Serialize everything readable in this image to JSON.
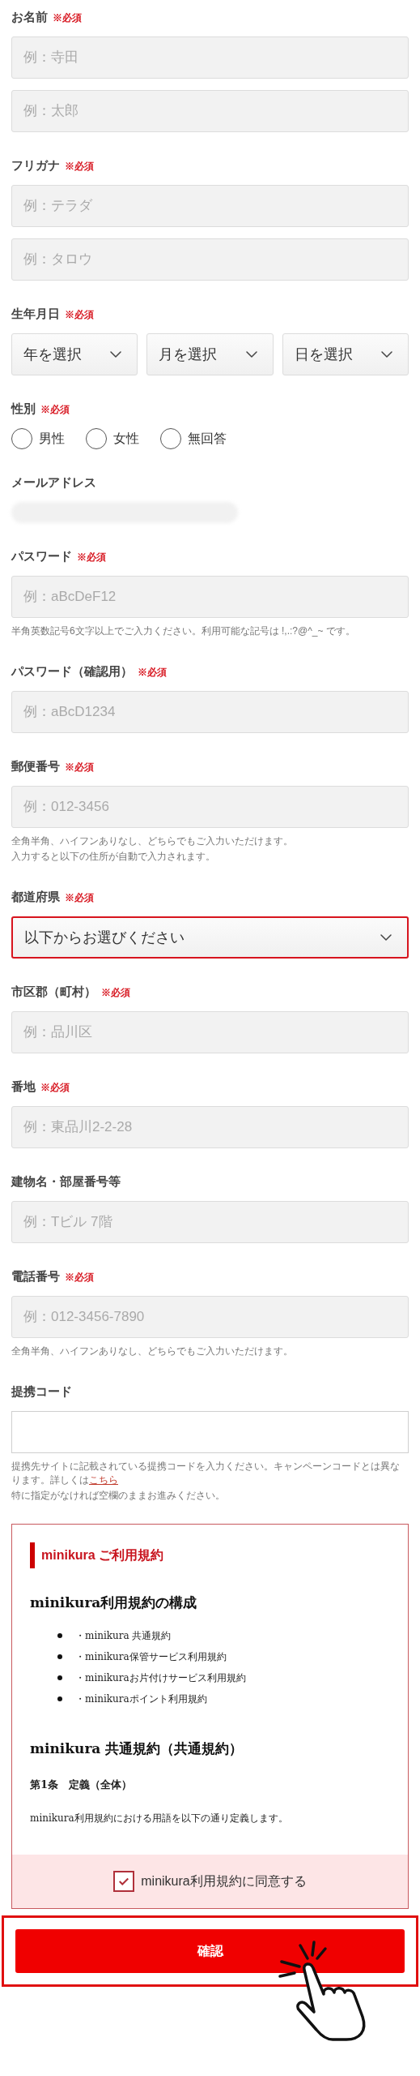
{
  "form": {
    "fields": [
      {
        "kind": "text",
        "label": "お名前",
        "required": "※必須",
        "inputs": [
          {
            "placeholder": "例：寺田"
          },
          {
            "placeholder": "例：太郎"
          }
        ]
      },
      {
        "kind": "text",
        "label": "フリガナ",
        "required": "※必須",
        "inputs": [
          {
            "placeholder": "例：テラダ"
          },
          {
            "placeholder": "例：タロウ"
          }
        ]
      },
      {
        "kind": "selects",
        "label": "生年月日",
        "required": "※必須",
        "selects": [
          {
            "value": "年を選択",
            "invalid": false
          },
          {
            "value": "月を選択",
            "invalid": false
          },
          {
            "value": "日を選択",
            "invalid": false
          }
        ]
      },
      {
        "kind": "radio",
        "label": "性別",
        "required": "※必須",
        "options": [
          {
            "label": "男性",
            "selected": false
          },
          {
            "label": "女性",
            "selected": false
          },
          {
            "label": "無回答",
            "selected": false
          }
        ]
      },
      {
        "kind": "redacted",
        "label": "メールアドレス"
      },
      {
        "kind": "text",
        "label": "パスワード",
        "required": "※必須",
        "inputs": [
          {
            "placeholder": "例：aBcDeF12"
          }
        ],
        "notes": [
          {
            "text": "半角英数記号6文字以上でご入力ください。利用可能な記号は !,.:?@^_~ です。"
          }
        ]
      },
      {
        "kind": "text",
        "label": "パスワード（確認用）",
        "required": "※必須",
        "inputs": [
          {
            "placeholder": "例：aBcD1234"
          }
        ]
      },
      {
        "kind": "text",
        "label": "郵便番号",
        "required": "※必須",
        "inputs": [
          {
            "placeholder": "例：012-3456"
          }
        ],
        "notes": [
          {
            "text": "全角半角、ハイフンありなし、どちらでもご入力いただけます。"
          },
          {
            "text": "入力すると以下の住所が自動で入力されます。"
          }
        ]
      },
      {
        "kind": "selects",
        "label": "都道府県",
        "required": "※必須",
        "selects": [
          {
            "value": "以下からお選びください",
            "invalid": true
          }
        ]
      },
      {
        "kind": "text",
        "label": "市区郡（町村）",
        "required": "※必須",
        "inputs": [
          {
            "placeholder": "例：品川区"
          }
        ]
      },
      {
        "kind": "text",
        "label": "番地",
        "required": "※必須",
        "inputs": [
          {
            "placeholder": "例：東品川2-2-28"
          }
        ]
      },
      {
        "kind": "text",
        "label": "建物名・部屋番号等",
        "inputs": [
          {
            "placeholder": "例：Tビル 7階"
          }
        ]
      },
      {
        "kind": "text",
        "label": "電話番号",
        "required": "※必須",
        "inputs": [
          {
            "placeholder": "例：012-3456-7890"
          }
        ],
        "notes": [
          {
            "text": "全角半角、ハイフンありなし、どちらでもご入力いただけます。"
          }
        ]
      },
      {
        "kind": "code",
        "label": "提携コード",
        "notes": [
          {
            "text": "提携先サイトに記載されている提携コードを入力ください。キャンペーンコードとは異なります。詳しくは",
            "link": "こちら"
          },
          {
            "text": "特に指定がなければ空欄のままお進みください。"
          }
        ]
      }
    ]
  },
  "terms": {
    "title": "minikura ご利用規約",
    "heading": "minikura利用規約の構成",
    "items": [
      "・minikura 共通規約",
      "・minikura保管サービス利用規約",
      "・minikuraお片付けサービス利用規約",
      "・minikuraポイント利用規約"
    ],
    "section_title": "minikura 共通規約（共通規約）",
    "article": "第1条　定義（全体）",
    "paragraph": "minikura利用規約における用語を以下の通り定義します。",
    "agree": {
      "label": "minikura利用規約に同意する",
      "checked": true
    }
  },
  "submit": {
    "label": "確認",
    "highlighted": true
  }
}
